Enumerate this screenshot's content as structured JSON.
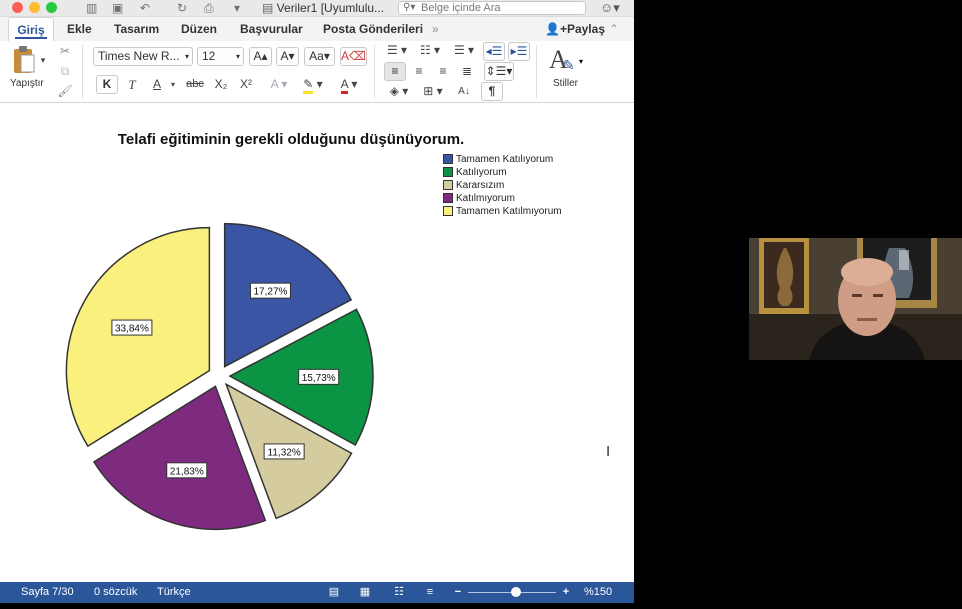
{
  "window": {
    "title": "Veriler1 [Uyumlulu...",
    "search_placeholder": "Belge içinde Ara",
    "share_label": "Paylaş"
  },
  "tabs": [
    "Giriş",
    "Ekle",
    "Tasarım",
    "Düzen",
    "Başvurular",
    "Posta Gönderileri"
  ],
  "ribbon": {
    "paste_label": "Yapıştır",
    "font_name": "Times New R...",
    "font_size": "12",
    "bold": "K",
    "italic": "T",
    "underline": "A",
    "strikethrough": "abc",
    "subscript": "X₂",
    "superscript": "X²",
    "styles_label": "Stiller",
    "pilcrow": "¶"
  },
  "chart_data": {
    "type": "pie",
    "title": "Telafi eğitiminin gerekli olduğunu düşünüyorum.",
    "categories": [
      "Tamamen Katılıyorum",
      "Katılıyorum",
      "Kararsızım",
      "Katılmıyorum",
      "Tamamen Katılmıyorum"
    ],
    "values": [
      17.27,
      15.73,
      11.32,
      21.83,
      33.84
    ],
    "value_labels": [
      "17,27%",
      "15,73%",
      "11,32%",
      "21,83%",
      "33,84%"
    ],
    "colors": [
      "#3a55a3",
      "#0b9444",
      "#d4cc9e",
      "#7e2b7f",
      "#faf07e"
    ],
    "exploded": true,
    "legend_position": "top-right"
  },
  "statusbar": {
    "page": "Sayfa 7/30",
    "words": "0 sözcük",
    "language": "Türkçe",
    "zoom": "%150",
    "zoom_level": 0.55
  }
}
